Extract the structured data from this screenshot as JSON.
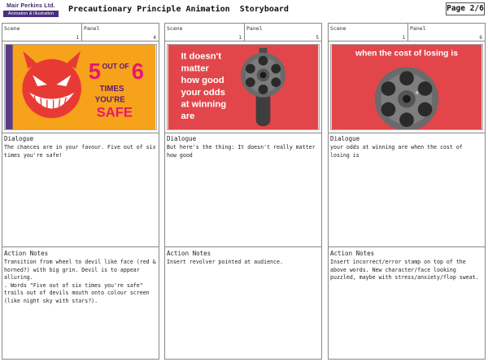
{
  "header": {
    "logo_name": "Mair Perkins Ltd.",
    "logo_tagline": "Animation & Illustration",
    "title": "Precautionary Principle Animation  Storyboard",
    "page": "Page 2/6"
  },
  "labels": {
    "scene": "Scene",
    "panel": "Panel",
    "dialogue": "Dialogue",
    "action_notes": "Action Notes"
  },
  "panels": [
    {
      "scene": "1",
      "panel": "4",
      "image_text": {
        "five": "5",
        "out_of": "OUT OF",
        "six": "6",
        "times": "TIMES",
        "youre": "YOU'RE",
        "safe": "SAFE"
      },
      "dialogue": "The chances are in your favour. Five out of six times you're safe!",
      "action_notes": [
        "Transition from wheel to devil like face (red & horned?) with big grin. Devil is to appear alluring.",
        ". Words \"Five out of six times you're safe\" trails out of devils mouth onto colour screen (like night sky with stars?)."
      ]
    },
    {
      "scene": "1",
      "panel": "5",
      "image_text": {
        "line1": "It doesn't",
        "line2": "matter",
        "line3": "how good",
        "line4": "your odds",
        "line5": "at winning",
        "line6": "are"
      },
      "dialogue": "But here's the thing: It doesn't really matter how good",
      "action_notes": [
        "Insert revolver pointed at audience."
      ]
    },
    {
      "scene": "1",
      "panel": "6",
      "image_text": {
        "line1": "when the cost of losing is"
      },
      "dialogue": "your odds at winning are when the cost of losing is",
      "action_notes": [
        "Insert incorrect/error stamp on top of the above words. New character/face looking puzzled, maybe with stress/anxiety/flop sweat."
      ]
    }
  ],
  "colors": {
    "frame1_bg": "#f7a21b",
    "frame1_stripe": "#5b3a8e",
    "devil_red": "#e83a35",
    "accent_pink": "#e8176f",
    "frame_red": "#e2464a",
    "gun_gray": "#505050"
  }
}
